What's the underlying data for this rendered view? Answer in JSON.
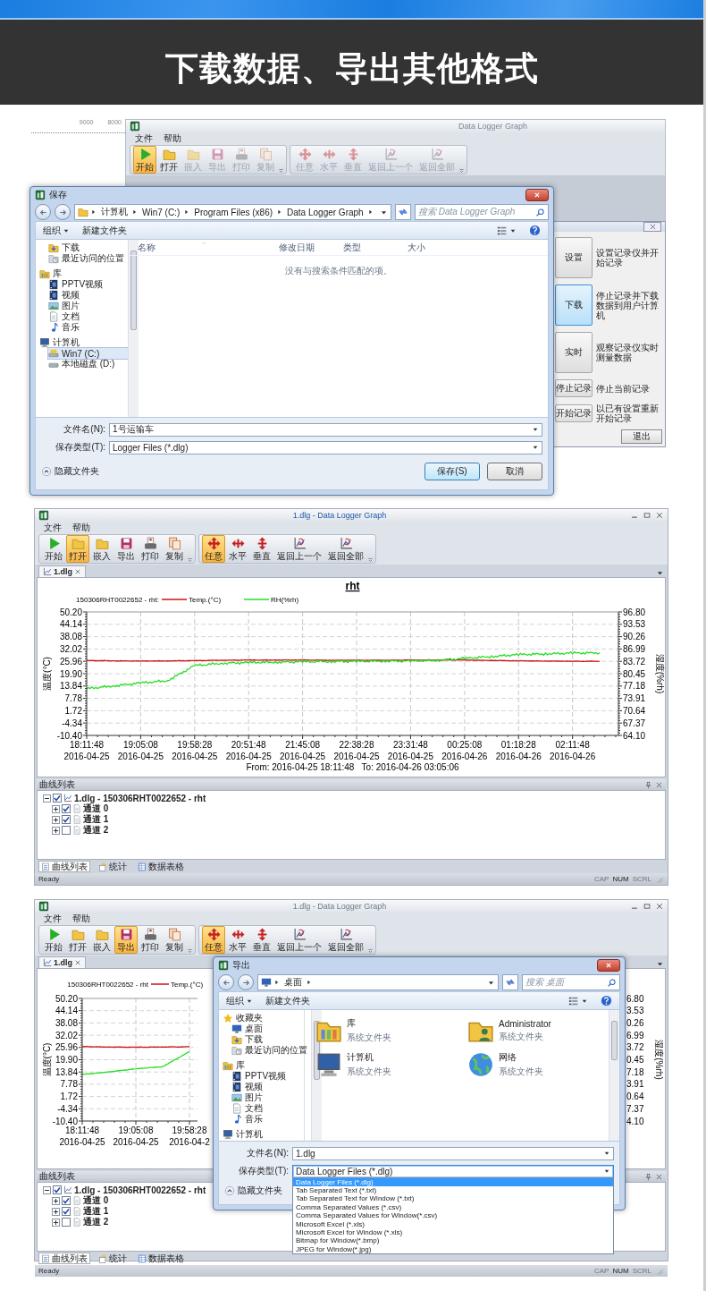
{
  "header": {
    "title": "下载数据、导出其他格式"
  },
  "shot1": {
    "ruler": {
      "labels": [
        "9000",
        "8000"
      ]
    },
    "app": {
      "title": "Data Logger Graph",
      "active": false,
      "menu": [
        "文件",
        "帮助"
      ],
      "toolbar": [
        {
          "items": [
            {
              "label": "开始",
              "selected": true,
              "disabled": false
            },
            {
              "label": "打开",
              "selected": false,
              "disabled": false
            },
            {
              "label": "嵌入",
              "selected": false,
              "disabled": true
            },
            {
              "label": "导出",
              "selected": false,
              "disabled": true
            },
            {
              "label": "打印",
              "selected": false,
              "disabled": true
            },
            {
              "label": "复制",
              "selected": false,
              "disabled": true
            }
          ]
        },
        {
          "items": [
            {
              "label": "任意",
              "selected": false,
              "disabled": true
            },
            {
              "label": "水平",
              "selected": false,
              "disabled": true
            },
            {
              "label": "垂直",
              "selected": false,
              "disabled": true
            },
            {
              "label": "返回上一个",
              "selected": false,
              "disabled": true
            },
            {
              "label": "返回全部",
              "selected": false,
              "disabled": true
            }
          ]
        }
      ]
    },
    "save_dialog": {
      "title": "保存",
      "path": [
        "计算机",
        "Win7 (C:)",
        "Program Files (x86)",
        "Data Logger Graph"
      ],
      "search_placeholder": "搜索 Data Logger Graph",
      "commands": [
        {
          "label": "组织",
          "kind": "menu"
        },
        {
          "label": "新建文件夹",
          "kind": "action"
        }
      ],
      "nav": [
        {
          "children": [
            {
              "label": "下载",
              "selected": false
            },
            {
              "label": "最近访问的位置",
              "selected": false
            }
          ]
        },
        {
          "label": "库",
          "selected": false,
          "children": [
            {
              "label": "PPTV视频",
              "selected": false
            },
            {
              "label": "视频",
              "selected": false
            },
            {
              "label": "图片",
              "selected": false
            },
            {
              "label": "文档",
              "selected": false
            },
            {
              "label": "音乐",
              "selected": false
            }
          ]
        },
        {
          "label": "计算机",
          "selected": false,
          "children": [
            {
              "label": "Win7 (C:)",
              "selected": true
            },
            {
              "label": "本地磁盘 (D:)",
              "selected": false
            }
          ]
        }
      ],
      "columns": [
        "名称",
        "修改日期",
        "类型",
        "大小"
      ],
      "empty_message": "没有与搜索条件匹配的项。",
      "filename": {
        "label": "文件名(N):",
        "value": "1号运输车"
      },
      "filetype": {
        "label": "保存类型(T):",
        "value": "Logger Files (*.dlg)",
        "expanded": false
      },
      "hide_folders": "隐藏文件夹",
      "buttons": [
        {
          "label": "保存(S)",
          "default": true
        },
        {
          "label": "取消",
          "default": false
        }
      ]
    },
    "control_panel": {
      "actions": [
        {
          "kind": "large",
          "label": "设置",
          "description": "设置记录仪并开始记录",
          "selected": false
        },
        {
          "kind": "large",
          "label": "下载",
          "description": "停止记录并下载数据到用户计算机",
          "selected": true
        },
        {
          "kind": "large",
          "label": "实时",
          "description": "观察记录仪实时测量数据",
          "selected": false
        },
        {
          "kind": "small",
          "label": "停止记录",
          "description": "停止当前记录",
          "selected": false
        },
        {
          "kind": "small",
          "label": "开始记录",
          "description": "以已有设置重新开始记录",
          "selected": false
        }
      ],
      "exit": "退出"
    }
  },
  "shot2": {
    "window": {
      "title": "1.dlg - Data Logger Graph",
      "active": true
    },
    "menu": [
      "文件",
      "帮助"
    ],
    "toolbar": [
      {
        "items": [
          {
            "label": "开始",
            "selected": false,
            "disabled": false
          },
          {
            "label": "打开",
            "selected": true,
            "disabled": false
          },
          {
            "label": "嵌入",
            "selected": false,
            "disabled": false
          },
          {
            "label": "导出",
            "selected": false,
            "disabled": false
          },
          {
            "label": "打印",
            "selected": false,
            "disabled": false
          },
          {
            "label": "复制",
            "selected": false,
            "disabled": false
          }
        ]
      },
      {
        "items": [
          {
            "label": "任意",
            "selected": true,
            "disabled": false
          },
          {
            "label": "水平",
            "selected": false,
            "disabled": false
          },
          {
            "label": "垂直",
            "selected": false,
            "disabled": false
          },
          {
            "label": "返回上一个",
            "selected": false,
            "disabled": false
          },
          {
            "label": "返回全部",
            "selected": false,
            "disabled": false
          }
        ]
      }
    ],
    "document_tab": "1.dlg",
    "legend_source": "150306RHT0022652 - rht:",
    "chart_data": {
      "type": "line",
      "title": "rht",
      "grid": true,
      "legend": "top",
      "xlabel": "From: 2016-04-25 18:11:48   To: 2016-04-26 03:05:06",
      "ylabel": "温度(°C)",
      "y2label": "湿度(%rh)",
      "categories": [
        "18:11:48\n2016-04-25",
        null,
        "19:05:08\n2016-04-25",
        null,
        "19:58:28\n2016-04-25",
        null,
        "20:51:48\n2016-04-25",
        null,
        "21:45:08\n2016-04-25",
        null,
        "22:38:28\n2016-04-25",
        null,
        "23:31:48\n2016-04-25",
        null,
        "00:25:08\n2016-04-26",
        null,
        "01:18:28\n2016-04-26",
        null,
        "02:11:48\n2016-04-26",
        null
      ],
      "ylim": [
        -10.4,
        50.2
      ],
      "y2lim": [
        64.1,
        96.8
      ],
      "yticks": [
        {
          "value": 50.2,
          "label": "50.20"
        },
        {
          "value": 44.14,
          "label": "44.14"
        },
        {
          "value": 38.08,
          "label": "38.08"
        },
        {
          "value": 32.02,
          "label": "32.02"
        },
        {
          "value": 25.96,
          "label": "25.96"
        },
        {
          "value": 19.9,
          "label": "19.90"
        },
        {
          "value": 13.84,
          "label": "13.84"
        },
        {
          "value": 7.78,
          "label": "7.78"
        },
        {
          "value": 1.72,
          "label": "1.72"
        },
        {
          "value": -4.34,
          "label": "-4.34"
        },
        {
          "value": -10.4,
          "label": "-10.40"
        }
      ],
      "y2ticks": [
        {
          "value": 96.8,
          "label": "96.80"
        },
        {
          "value": 93.53,
          "label": "93.53"
        },
        {
          "value": 90.26,
          "label": "90.26"
        },
        {
          "value": 86.99,
          "label": "86.99"
        },
        {
          "value": 83.72,
          "label": "83.72"
        },
        {
          "value": 80.45,
          "label": "80.45"
        },
        {
          "value": 77.18,
          "label": "77.18"
        },
        {
          "value": 73.91,
          "label": "73.91"
        },
        {
          "value": 70.64,
          "label": "70.64"
        },
        {
          "value": 67.37,
          "label": "67.37"
        },
        {
          "value": 64.1,
          "label": "64.10"
        }
      ],
      "series": [
        {
          "name": "Temp.(°C)",
          "color": "#d01010",
          "values": [
            26.4,
            26.2,
            26.1,
            26.2,
            26.3,
            26.5,
            26.6,
            26.6,
            26.6,
            26.5,
            26.5,
            26.5,
            26.6,
            26.6,
            26.6,
            26.4,
            26.2,
            26.1,
            26.0,
            26.0
          ]
        },
        {
          "name": "RH(%rh)",
          "color": "#22e022",
          "axis": "y2",
          "values": [
            76.5,
            77.2,
            78.0,
            78.6,
            82.6,
            83.2,
            83.4,
            83.5,
            83.6,
            83.7,
            83.7,
            83.8,
            83.8,
            84.0,
            84.5,
            85.0,
            85.5,
            85.7,
            85.9,
            86.0
          ]
        }
      ]
    },
    "curve_panel": {
      "title": "曲线列表",
      "tree": [
        {
          "label": "1.dlg - 150306RHT0022652 - rht",
          "checked": true,
          "expanded": true,
          "children": [
            {
              "label": "通道 0",
              "checked": true,
              "expanded": false
            },
            {
              "label": "通道 1",
              "checked": true,
              "expanded": false
            },
            {
              "label": "通道 2",
              "checked": false,
              "expanded": false
            }
          ]
        }
      ]
    },
    "bottom_tabs": [
      {
        "label": "曲线列表",
        "selected": true
      },
      {
        "label": "统计",
        "selected": false
      },
      {
        "label": "数据表格",
        "selected": false
      }
    ],
    "status_bar": {
      "text": "Ready",
      "indicators": [
        {
          "label": "CAP",
          "on": false
        },
        {
          "label": "NUM",
          "on": true
        },
        {
          "label": "SCRL",
          "on": false
        }
      ]
    }
  },
  "shot3": {
    "window": {
      "title": "1.dlg - Data Logger Graph",
      "active": false
    },
    "menu": [
      "文件",
      "帮助"
    ],
    "toolbar": [
      {
        "items": [
          {
            "label": "开始",
            "selected": false,
            "disabled": false
          },
          {
            "label": "打开",
            "selected": false,
            "disabled": false
          },
          {
            "label": "嵌入",
            "selected": false,
            "disabled": false
          },
          {
            "label": "导出",
            "selected": true,
            "disabled": false
          },
          {
            "label": "打印",
            "selected": false,
            "disabled": false
          },
          {
            "label": "复制",
            "selected": false,
            "disabled": false
          }
        ]
      },
      {
        "items": [
          {
            "label": "任意",
            "selected": true,
            "disabled": false
          },
          {
            "label": "水平",
            "selected": false,
            "disabled": false
          },
          {
            "label": "垂直",
            "selected": false,
            "disabled": false
          },
          {
            "label": "返回上一个",
            "selected": false,
            "disabled": false
          },
          {
            "label": "返回全部",
            "selected": false,
            "disabled": false
          }
        ]
      }
    ],
    "document_tab": "1.dlg",
    "legend_source": "150306RHT0022652 - rht",
    "chart_data": {
      "type": "line",
      "grid": true,
      "legend": "top",
      "ylabel": "温度(°C)",
      "categories": [
        "18:11:48\n2016-04-25",
        null,
        "19:05:08\n2016-04-25",
        null,
        "19:58:28\n2016-04-2"
      ],
      "ylim": [
        -10.4,
        50.2
      ],
      "yticks": [
        {
          "value": 50.2,
          "label": "50.20"
        },
        {
          "value": 44.14,
          "label": "44.14"
        },
        {
          "value": 38.08,
          "label": "38.08"
        },
        {
          "value": 32.02,
          "label": "32.02"
        },
        {
          "value": 25.96,
          "label": "25.96"
        },
        {
          "value": 19.9,
          "label": "19.90"
        },
        {
          "value": 13.84,
          "label": "13.84"
        },
        {
          "value": 7.78,
          "label": "7.78"
        },
        {
          "value": 1.72,
          "label": "1.72"
        },
        {
          "value": -4.34,
          "label": "-4.34"
        },
        {
          "value": -10.4,
          "label": "-10.40"
        }
      ],
      "series": [
        {
          "name": "Temp.(°C)",
          "color": "#d01010",
          "values": [
            26.4,
            26.2,
            26.1,
            26.2,
            26.3
          ]
        },
        {
          "color": "#22e022",
          "values": [
            12.6,
            13.9,
            15.4,
            16.5,
            23.9
          ]
        }
      ]
    },
    "right_axis_fragment": {
      "labels": [
        "6.80",
        "3.53",
        "0.26",
        "6.99",
        "3.72",
        "0.45",
        "7.18",
        "3.91",
        "0.64",
        "7.37",
        "4.10"
      ],
      "title": "湿度(%rh)"
    },
    "export_dialog": {
      "title": "导出",
      "path": [
        "桌面"
      ],
      "search_placeholder": "搜索 桌面",
      "commands": [
        {
          "label": "组织",
          "kind": "menu"
        },
        {
          "label": "新建文件夹",
          "kind": "action"
        }
      ],
      "nav": [
        {
          "label": "收藏夹",
          "selected": false,
          "children": [
            {
              "label": "桌面",
              "selected": false
            },
            {
              "label": "下载",
              "selected": false
            },
            {
              "label": "最近访问的位置",
              "selected": false
            }
          ]
        },
        {
          "label": "库",
          "selected": false,
          "children": [
            {
              "label": "PPTV视频",
              "selected": false
            },
            {
              "label": "视频",
              "selected": false
            },
            {
              "label": "图片",
              "selected": false
            },
            {
              "label": "文档",
              "selected": false
            },
            {
              "label": "音乐",
              "selected": false
            }
          ]
        },
        {
          "label": "计算机",
          "selected": false
        }
      ],
      "items": [
        {
          "name": "库",
          "type": "系统文件夹"
        },
        {
          "name": "Administrator",
          "type": "系统文件夹"
        },
        {
          "name": "计算机",
          "type": "系统文件夹"
        },
        {
          "name": "网络",
          "type": "系统文件夹"
        }
      ],
      "filename": {
        "label": "文件名(N):",
        "value": "1.dlg"
      },
      "filetype": {
        "label": "保存类型(T):",
        "value": "Data Logger Files (*.dlg)",
        "expanded": true,
        "options": [
          {
            "label": "Data Logger Files (*.dlg)",
            "selected": true
          },
          {
            "label": "Tab Separated Text (*.txt)",
            "selected": false
          },
          {
            "label": "Tab Separated Text for Window (*.txt)",
            "selected": false
          },
          {
            "label": "Comma Separated Values (*.csv)",
            "selected": false
          },
          {
            "label": "Comma Separated Values for Window(*.csv)",
            "selected": false
          },
          {
            "label": "Microsoft Excel (*.xls)",
            "selected": false
          },
          {
            "label": "Microsoft Excel for Window (*.xls)",
            "selected": false
          },
          {
            "label": "Bitmap for Window(*.bmp)",
            "selected": false
          },
          {
            "label": "JPEG for Window(*.jpg)",
            "selected": false
          }
        ]
      },
      "hide_folders": "隐藏文件夹"
    },
    "curve_panel": {
      "title": "曲线列表",
      "tree": [
        {
          "label": "1.dlg - 150306RHT0022652 - rht",
          "checked": true,
          "expanded": true,
          "children": [
            {
              "label": "通道 0",
              "checked": true,
              "expanded": false
            },
            {
              "label": "通道 1",
              "checked": true,
              "expanded": false
            },
            {
              "label": "通道 2",
              "checked": false,
              "expanded": false
            }
          ]
        }
      ]
    },
    "bottom_tabs": [
      {
        "label": "曲线列表",
        "selected": true
      },
      {
        "label": "统计",
        "selected": false
      },
      {
        "label": "数据表格",
        "selected": false
      }
    ],
    "status_bar": {
      "text": "Ready",
      "indicators": [
        {
          "label": "CAP",
          "on": false
        },
        {
          "label": "NUM",
          "on": true
        },
        {
          "label": "SCRL",
          "on": false
        }
      ]
    }
  }
}
